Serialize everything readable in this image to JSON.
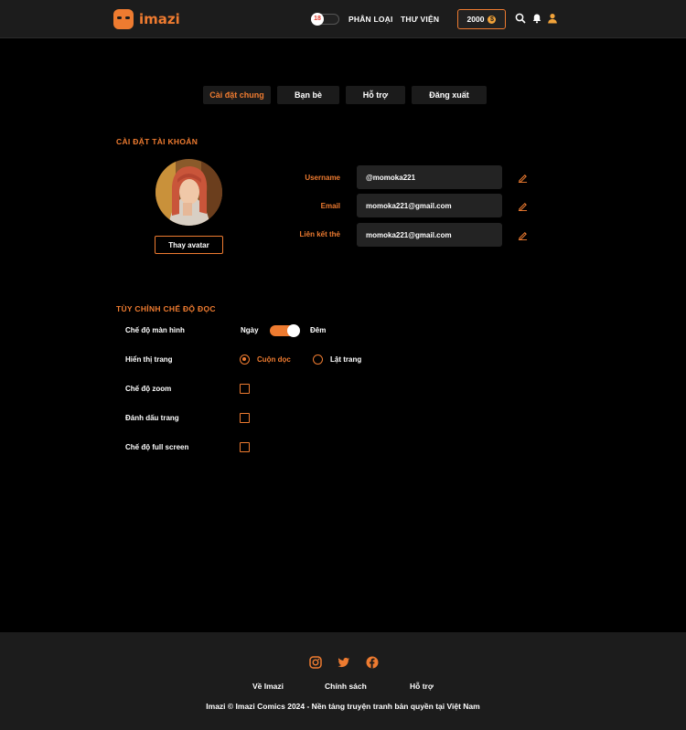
{
  "header": {
    "logo_text": "imazi",
    "age_badge": "18",
    "nav": [
      "PHÂN LOẠI",
      "THƯ VIỆN"
    ],
    "coins": "2000",
    "coin_symbol": "$",
    "icons": [
      "search-icon",
      "bell-icon",
      "user-icon"
    ]
  },
  "tabs": [
    "Cài đặt chung",
    "Bạn bè",
    "Hỗ trợ",
    "Đăng xuất"
  ],
  "account": {
    "title": "CÀI ĐẶT TÀI KHOẢN",
    "change_avatar": "Thay avatar",
    "fields": [
      {
        "label": "Username",
        "value": "@momoka221"
      },
      {
        "label": "Email",
        "value": "momoka221@gmail.com"
      },
      {
        "label": "Liên kết thẻ",
        "value": "momoka221@gmail.com"
      }
    ]
  },
  "reading": {
    "title": "TÙY CHỈNH CHẾ ĐỘ ĐỌC",
    "screen_mode_label": "Chế độ màn hình",
    "day": "Ngày",
    "night": "Đêm",
    "display_label": "Hiển thị trang",
    "scroll_option": "Cuộn dọc",
    "flip_option": "Lật trang",
    "zoom_label": "Chế độ zoom",
    "bookmark_label": "Đánh dấu trang",
    "fullscreen_label": "Chế độ full screen"
  },
  "footer": {
    "socials": [
      "instagram-icon",
      "twitter-icon",
      "facebook-icon"
    ],
    "links": [
      "Về Imazi",
      "Chính sách",
      "Hỗ trợ"
    ],
    "copyright": "Imazi © Imazi Comics 2024  - Nền tảng truyện tranh bản quyền tại Việt Nam"
  },
  "colors": {
    "accent": "#ee7b30",
    "background": "#000000",
    "panel": "#1c1c1c",
    "field": "#232323"
  }
}
